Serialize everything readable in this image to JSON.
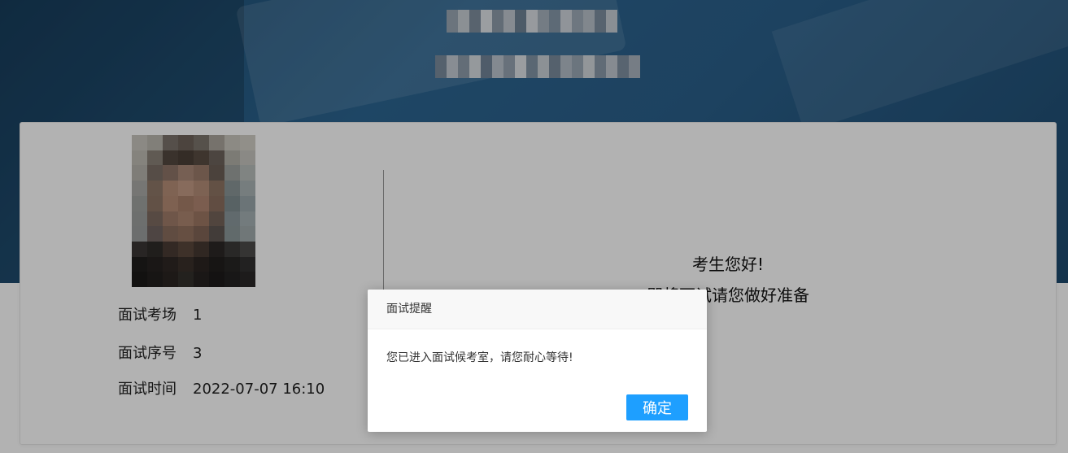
{
  "banner": {
    "bg_colors": [
      "#1d4b70",
      "#2c6591",
      "#1e4a6e"
    ]
  },
  "candidate": {
    "photo_icon": "candidate-photo",
    "info": [
      {
        "label": "面试考场",
        "value": "1"
      },
      {
        "label": "面试序号",
        "value": "3"
      },
      {
        "label": "面试时间",
        "value": "2022-07-07 16:10"
      }
    ]
  },
  "greeting": {
    "line1": "考生您好!",
    "line2": "即将面试请您做好准备"
  },
  "dialog": {
    "title": "面试提醒",
    "message": "您已进入面试候考室，请您耐心等待!",
    "confirm_label": "确定",
    "accent_color": "#1e9fff"
  }
}
